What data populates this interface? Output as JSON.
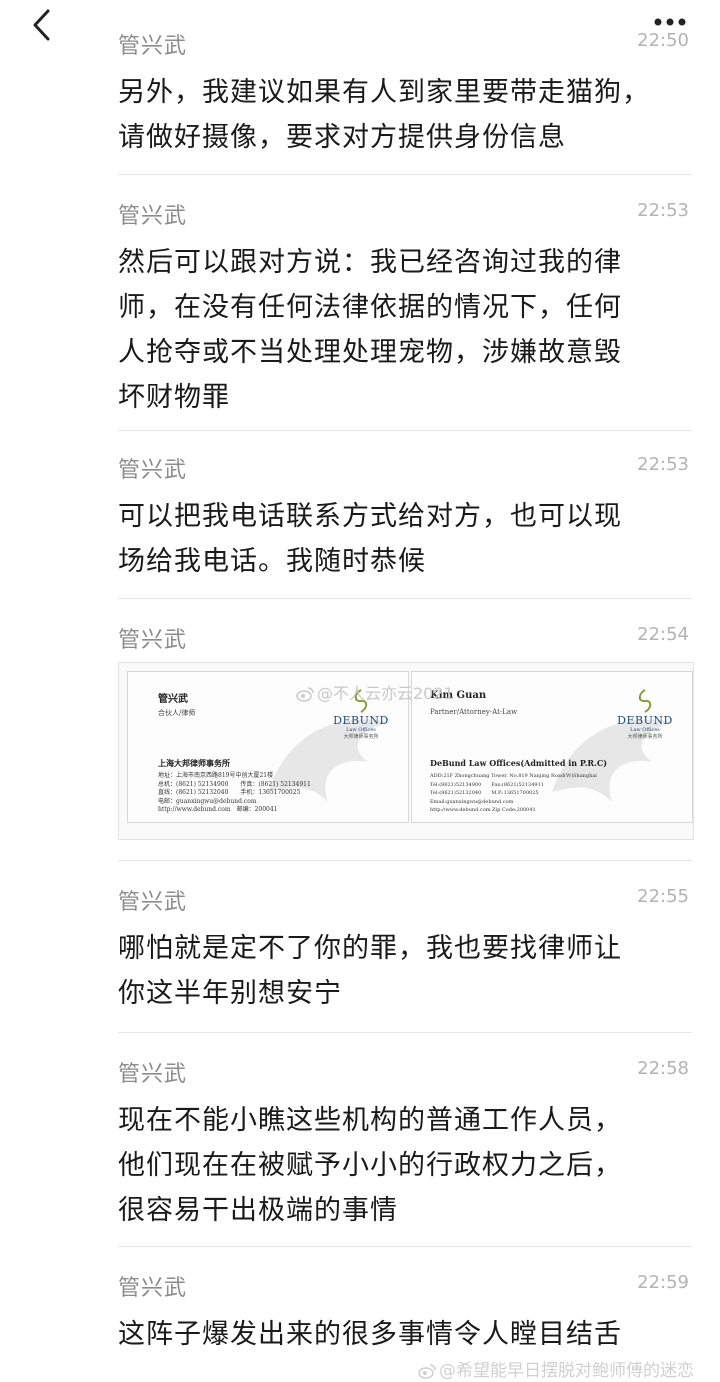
{
  "header": {
    "back_icon": "chevron-left-icon",
    "more_icon": "more-dots-icon"
  },
  "messages": [
    {
      "sender": "管兴武",
      "time": "22:50",
      "lines": [
        "另外，我建议如果有人到家里要带走猫狗，",
        "请做好摄像，要求对方提供身份信息"
      ]
    },
    {
      "sender": "管兴武",
      "time": "22:53",
      "lines": [
        "然后可以跟对方说：我已经咨询过我的律",
        "师，在没有任何法律依据的情况下，任何",
        "人抢夺或不当处理处理宠物，涉嫌故意毁",
        "坏财物罪"
      ]
    },
    {
      "sender": "管兴武",
      "time": "22:53",
      "lines": [
        "可以把我电话联系方式给对方，也可以现",
        "场给我电话。我随时恭候"
      ]
    },
    {
      "sender": "管兴武",
      "time": "22:54",
      "card_cn": {
        "name": "管兴武",
        "title": "合伙人/律师",
        "firm": "上海大邦律师事务所",
        "lines": [
          "地址：上海市南京西路819号中创大厦21楼",
          "总机：(8621) 52134900　　传真：(8621) 52134911",
          "直线：(8621) 52132040　　手机：13651700025",
          "电邮：guanxingwu@debund.com",
          "http://www.debund.com　邮编：200041"
        ]
      },
      "card_en": {
        "name": "Kim Guan",
        "title": "Partner/Attorney-At-Law",
        "firm": "DeBund Law Offices(Admitted in P.R.C)",
        "lines": [
          "ADD:21F Zhongchuang Tower, No.819 Nanjing Road(W)Shanghai",
          "Tel:(8621)52134900　　Fax:(8621)52134911",
          "Tel:(8621)52132040　　M.P.:13651700025",
          "Email:guanxingwu@debund.com",
          "http://www.debund.com  Zip Code:200041"
        ]
      },
      "logo": {
        "brand": "DEBUND",
        "sub": "Law Offices",
        "sub_cn": "大邦律师事务所"
      }
    },
    {
      "sender": "管兴武",
      "time": "22:55",
      "lines": [
        "哪怕就是定不了你的罪，我也要找律师让",
        "你这半年别想安宁"
      ]
    },
    {
      "sender": "管兴武",
      "time": "22:58",
      "lines": [
        "现在不能小瞧这些机构的普通工作人员，",
        "他们现在在被赋予小小的行政权力之后，",
        "很容易干出极端的事情"
      ]
    },
    {
      "sender": "管兴武",
      "time": "22:59",
      "lines": [
        "这阵子爆发出来的很多事情令人瞠目结舌"
      ]
    }
  ],
  "watermarks": {
    "center": "@不人云亦云2021",
    "bottom": "@希望能早日摆脱对鲍师傅的迷恋"
  }
}
